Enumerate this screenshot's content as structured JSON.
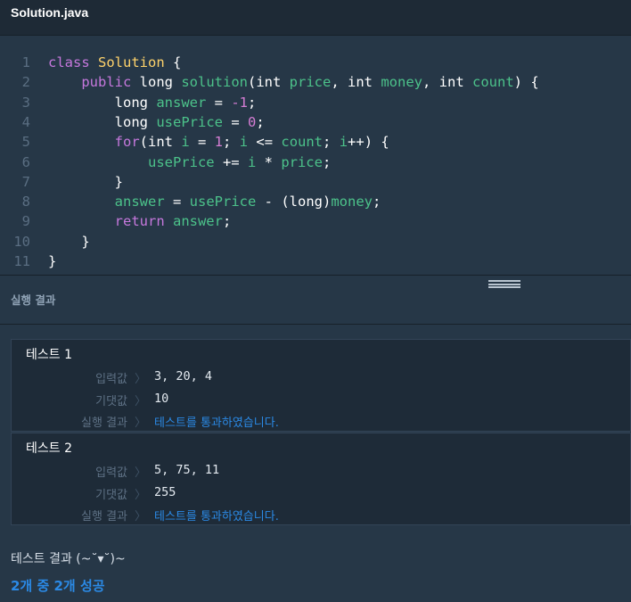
{
  "tab": {
    "title": "Solution.java"
  },
  "code": {
    "line_numbers": [
      "1",
      "2",
      "3",
      "4",
      "5",
      "6",
      "7",
      "8",
      "9",
      "10",
      "11"
    ],
    "lines": [
      [
        [
          "kw",
          "class "
        ],
        [
          "cls",
          "Solution"
        ],
        [
          "pl",
          " {"
        ]
      ],
      [
        [
          "kw",
          "    public "
        ],
        [
          "ty",
          "long "
        ],
        [
          "fn",
          "solution"
        ],
        [
          "pl",
          "("
        ],
        [
          "ty",
          "int "
        ],
        [
          "var",
          "price"
        ],
        [
          "pl",
          ", "
        ],
        [
          "ty",
          "int "
        ],
        [
          "var",
          "money"
        ],
        [
          "pl",
          ", "
        ],
        [
          "ty",
          "int "
        ],
        [
          "var",
          "count"
        ],
        [
          "pl",
          ") {"
        ]
      ],
      [
        [
          "ty",
          "        long "
        ],
        [
          "var",
          "answer"
        ],
        [
          "op",
          " = "
        ],
        [
          "num",
          "-1"
        ],
        [
          "pl",
          ";"
        ]
      ],
      [
        [
          "ty",
          "        long "
        ],
        [
          "var",
          "usePrice"
        ],
        [
          "op",
          " = "
        ],
        [
          "num",
          "0"
        ],
        [
          "pl",
          ";"
        ]
      ],
      [
        [
          "kw",
          "        for"
        ],
        [
          "pl",
          "("
        ],
        [
          "ty",
          "int "
        ],
        [
          "var",
          "i"
        ],
        [
          "op",
          " = "
        ],
        [
          "num",
          "1"
        ],
        [
          "pl",
          "; "
        ],
        [
          "var",
          "i"
        ],
        [
          "op",
          " <= "
        ],
        [
          "var",
          "count"
        ],
        [
          "pl",
          "; "
        ],
        [
          "var",
          "i"
        ],
        [
          "op",
          "++"
        ],
        [
          "pl",
          ") {"
        ]
      ],
      [
        [
          "var",
          "            usePrice"
        ],
        [
          "op",
          " += "
        ],
        [
          "var",
          "i"
        ],
        [
          "op",
          " * "
        ],
        [
          "var",
          "price"
        ],
        [
          "pl",
          ";"
        ]
      ],
      [
        [
          "pl",
          "        }"
        ]
      ],
      [
        [
          "var",
          "        answer"
        ],
        [
          "op",
          " = "
        ],
        [
          "var",
          "usePrice"
        ],
        [
          "op",
          " - "
        ],
        [
          "pl",
          "("
        ],
        [
          "ty",
          "long"
        ],
        [
          "pl",
          ")"
        ],
        [
          "var",
          "money"
        ],
        [
          "pl",
          ";"
        ]
      ],
      [
        [
          "kw",
          "        return "
        ],
        [
          "var",
          "answer"
        ],
        [
          "pl",
          ";"
        ]
      ],
      [
        [
          "pl",
          "    }"
        ]
      ],
      [
        [
          "pl",
          "}"
        ]
      ]
    ]
  },
  "results": {
    "header": "실행 결과",
    "tests": [
      {
        "title": "테스트 1",
        "input_label": "입력값",
        "input_value": "3, 20, 4",
        "expected_label": "기댓값",
        "expected_value": "10",
        "result_label": "실행 결과",
        "result_value": "테스트를 통과하였습니다."
      },
      {
        "title": "테스트 2",
        "input_label": "입력값",
        "input_value": "5, 75, 11",
        "expected_label": "기댓값",
        "expected_value": "255",
        "result_label": "실행 결과",
        "result_value": "테스트를 통과하였습니다."
      }
    ],
    "separator": "〉"
  },
  "summary": {
    "title": "테스트 결과 (~˘▾˘)~",
    "result": "2개 중 2개 성공"
  },
  "colors": {
    "background": "#263747",
    "keyword": "#c678dd",
    "class_name": "#ffd36b",
    "identifier": "#4cc28a",
    "number": "#d47dd3",
    "pass": "#2b8ae6"
  }
}
